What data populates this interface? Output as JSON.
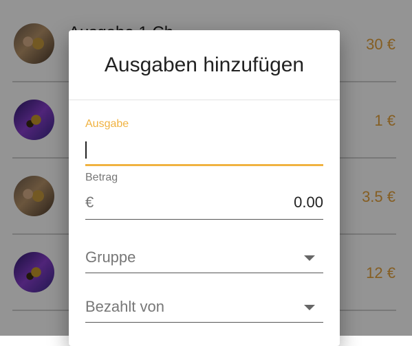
{
  "list": {
    "items": [
      {
        "name": "Ausgabe 1 Ch",
        "amount": "30 €",
        "avatar": "person-photo"
      },
      {
        "name": "",
        "amount": "1 €",
        "avatar": "bee-photo"
      },
      {
        "name": "",
        "amount": "3.5 €",
        "avatar": "person-photo"
      },
      {
        "name": "",
        "amount": "12 €",
        "avatar": "bee-photo"
      }
    ]
  },
  "dialog": {
    "title": "Ausgaben hinzufügen",
    "expense_label": "Ausgabe",
    "expense_value": "",
    "amount_label": "Betrag",
    "currency_symbol": "€",
    "amount_value": "0.00",
    "group_placeholder": "Gruppe",
    "paid_by_placeholder": "Bezahlt von"
  },
  "colors": {
    "accent": "#f0b240",
    "amount_text": "#e6a23c",
    "overlay": "rgba(0,0,0,0.42)"
  },
  "icons": {
    "dropdown": "chevron-down-icon"
  }
}
